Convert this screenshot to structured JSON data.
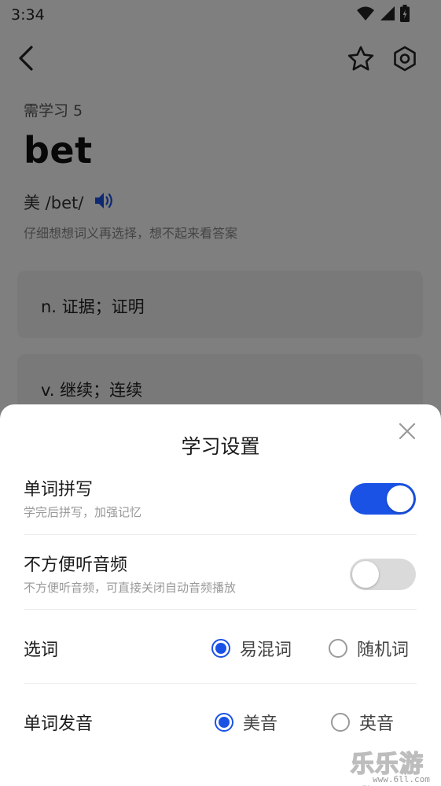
{
  "status": {
    "time": "3:34"
  },
  "word_card": {
    "study_count": "需学习 5",
    "word": "bet",
    "phonetic": "美 /bet/",
    "hint": "仔细想想词义再选择，想不起来看答案",
    "options": [
      "n. 证据；证明",
      "v. 继续；连续"
    ]
  },
  "settings": {
    "title": "学习设置",
    "spelling": {
      "title": "单词拼写",
      "subtitle": "学完后拼写，加强记忆",
      "enabled": true
    },
    "audio": {
      "title": "不方便听音频",
      "subtitle": "不方便听音频，可直接关闭自动音频播放",
      "enabled": false
    },
    "word_pick": {
      "label": "选词",
      "options": [
        "易混词",
        "随机词"
      ],
      "selected": "易混词"
    },
    "pronunciation": {
      "label": "单词发音",
      "options": [
        "美音",
        "英音"
      ],
      "selected": "美音"
    }
  },
  "watermark": {
    "text": "乐乐游戏",
    "url": "www.6ll.com"
  },
  "colors": {
    "accent": "#1a52e6",
    "toggle_off": "#dadada"
  },
  "icons": [
    "back-arrow-icon",
    "star-icon",
    "gear-icon",
    "speaker-icon",
    "close-icon",
    "wifi-icon",
    "signal-icon",
    "battery-icon"
  ]
}
